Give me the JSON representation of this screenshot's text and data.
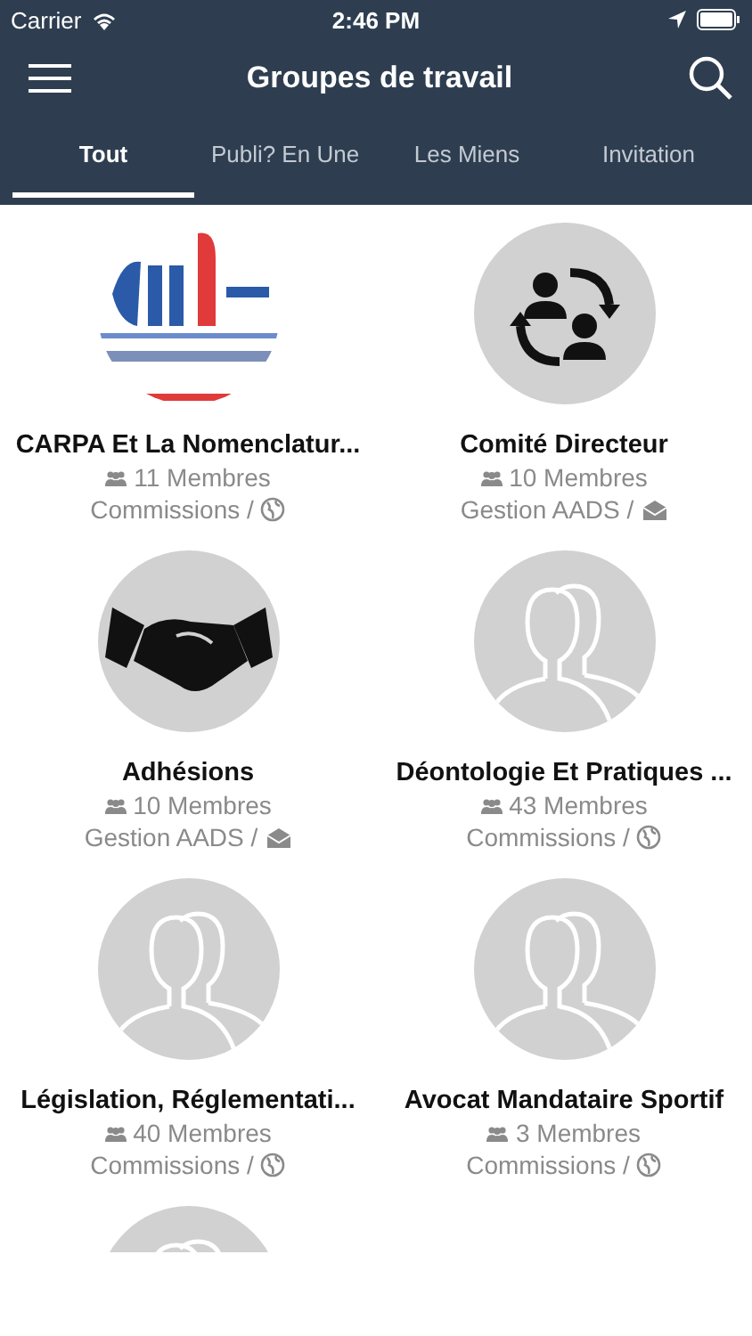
{
  "status_bar": {
    "carrier": "Carrier",
    "time": "2:46 PM"
  },
  "nav": {
    "title": "Groupes de travail"
  },
  "tabs": [
    {
      "label": "Tout",
      "selected": true
    },
    {
      "label": "Publi? En Une",
      "selected": false
    },
    {
      "label": "Les Miens",
      "selected": false
    },
    {
      "label": "Invitation",
      "selected": false
    }
  ],
  "groups": [
    {
      "kind": "picture",
      "title": "CARPA Et La Nomenclatur...",
      "members": "11 Membres",
      "category": "Commissions /",
      "private": false
    },
    {
      "kind": "exchange",
      "title": "Comité Directeur",
      "members": "10 Membres",
      "category": "Gestion AADS /",
      "private": true
    },
    {
      "kind": "handshake",
      "title": "Adhésions",
      "members": "10 Membres",
      "category": "Gestion AADS /",
      "private": true
    },
    {
      "kind": "people",
      "title": "Déontologie Et Pratiques ...",
      "members": "43 Membres",
      "category": "Commissions /",
      "private": false
    },
    {
      "kind": "people",
      "title": "Législation, Réglementati...",
      "members": "40 Membres",
      "category": "Commissions /",
      "private": false
    },
    {
      "kind": "people",
      "title": "Avocat Mandataire Sportif",
      "members": "3 Membres",
      "category": "Commissions /",
      "private": false
    },
    {
      "kind": "people"
    }
  ]
}
